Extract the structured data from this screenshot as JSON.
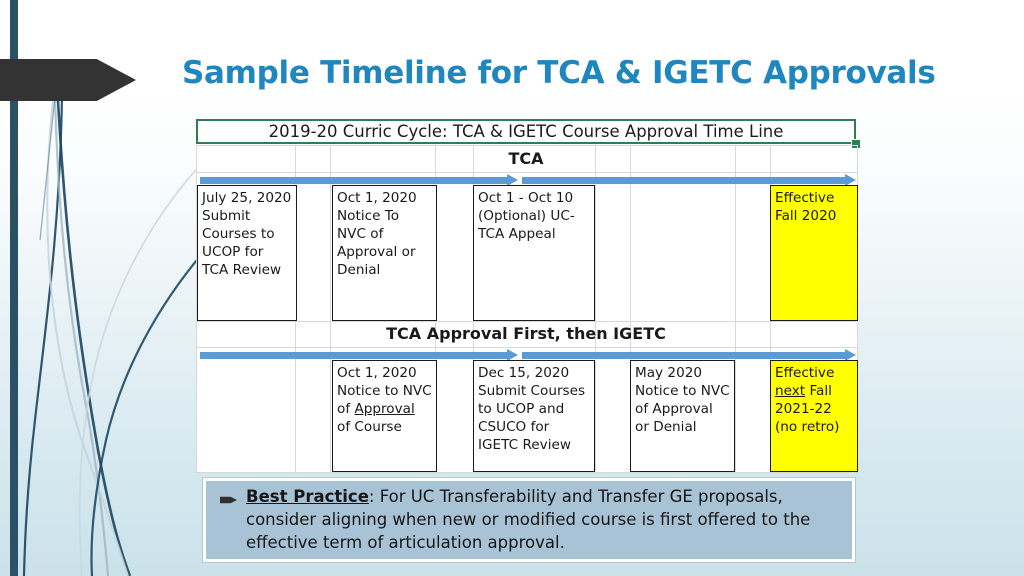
{
  "slide": {
    "title": "Sample Timeline for TCA & IGETC Approvals",
    "title_color": "#1f86c0",
    "accent_bar_color": "#2b5167",
    "banner_color": "#333333"
  },
  "sheet": {
    "title": "2019-20 Curric Cycle: TCA & IGETC  Course Approval Time Line",
    "border_color": "#2e7d55",
    "arrow_color": "#5b9bd5",
    "highlight_color": "#ffff00",
    "bands": [
      {
        "label": "TCA",
        "cells": [
          {
            "text": "July 25, 2020 Submit Courses to UCOP for TCA Review",
            "highlight": false
          },
          {
            "text": "Oct 1, 2020 Notice To NVC of Approval or Denial",
            "highlight": false
          },
          {
            "text": "Oct 1 - Oct 10 (Optional) UC-TCA Appeal",
            "highlight": false
          },
          {
            "text": "Effective Fall 2020",
            "highlight": true
          }
        ]
      },
      {
        "label": "TCA Approval First, then IGETC",
        "cells": [
          {
            "text": "Oct 1, 2020 Notice to NVC of Approval of Course",
            "highlight": false
          },
          {
            "text": "Dec 15, 2020 Submit Courses to UCOP and CSUCO for IGETC Review",
            "highlight": false
          },
          {
            "text": "May 2020 Notice to NVC of Approval or Denial",
            "highlight": false
          },
          {
            "text": "Effective next Fall 2021-22 (no retro)",
            "highlight": true
          }
        ]
      }
    ]
  },
  "callout": {
    "lead": "Best Practice",
    "body": ":  For UC Transferability and Transfer GE proposals, consider aligning when new or modified course is first offered to the effective term of articulation approval.",
    "bullet_icon": "arrow-bullet-icon",
    "background_color": "#a9c3d6"
  }
}
